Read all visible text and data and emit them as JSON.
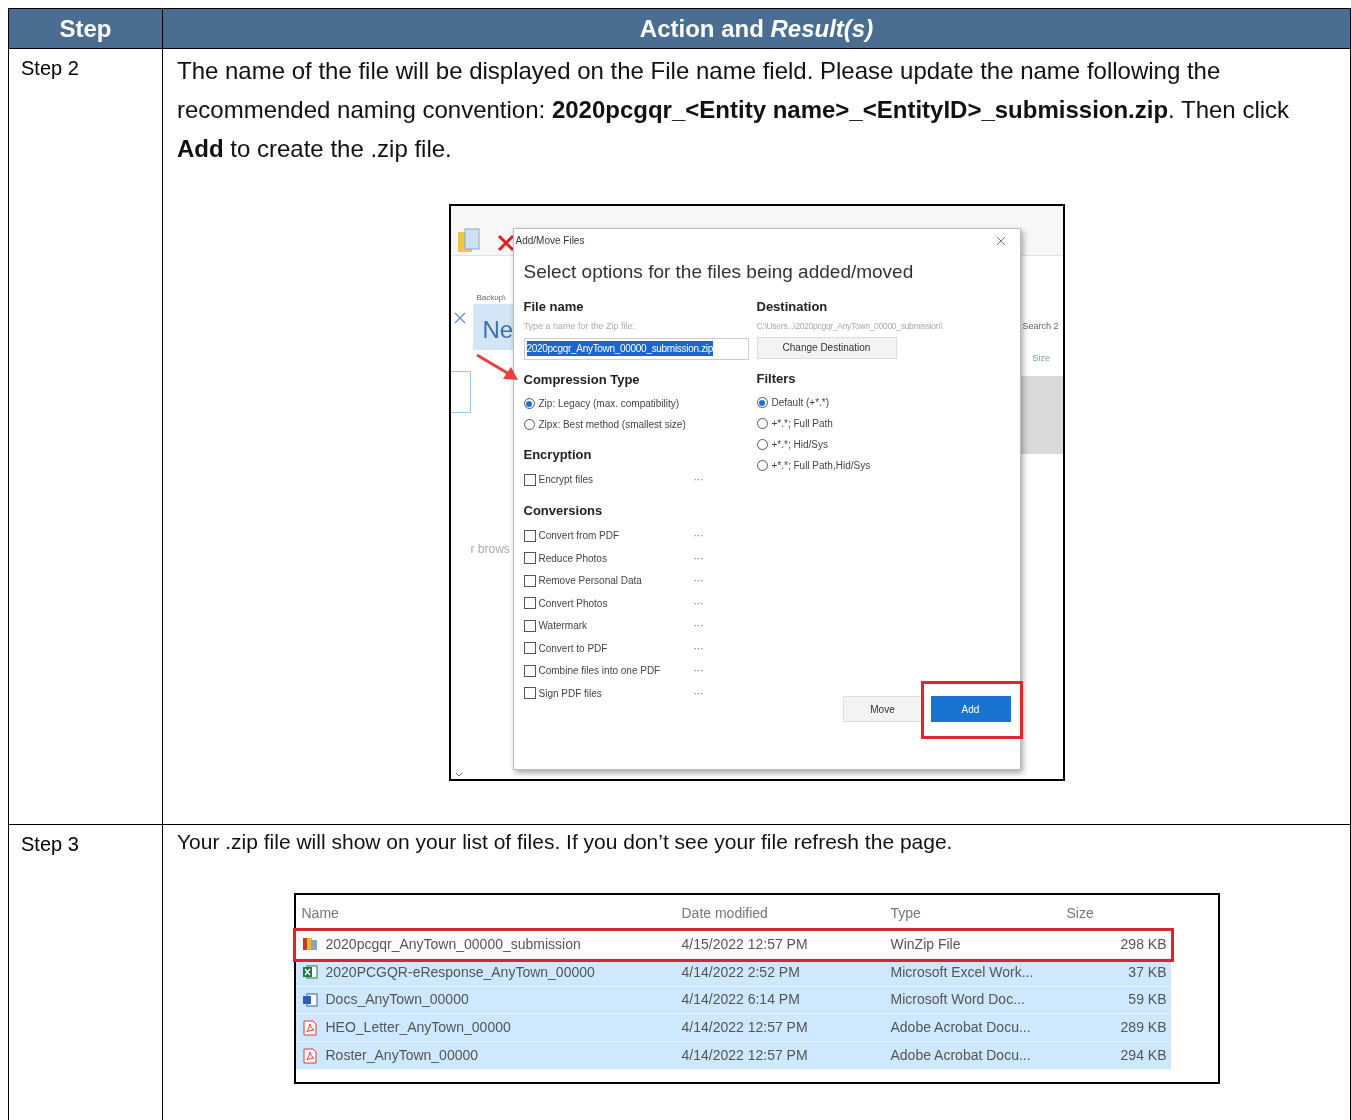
{
  "table": {
    "columns": [
      "Step",
      "Action and *Result(s)*"
    ],
    "rows": [
      {
        "step": "Step 2",
        "instruction": "The name of the file will be displayed on the File name field. Please update the name following the recommended naming convention: **2020pcgqr_<Entity name>_<EntityID>_submission.zip**. Then click **Add** to create the .zip file.",
        "screenshot": {
          "kind": "dialog",
          "background": {
            "breadcrumb": "Backup\\",
            "tile_label": "Ne",
            "search_hint": "Search 2",
            "column_header": "Size",
            "hint_fragment": "r brows"
          },
          "dialog": {
            "title": "Add/Move Files",
            "heading": "Select options for the files being added/moved",
            "file_name": {
              "label": "File name",
              "hint": "Type a name for the Zip file:",
              "value": "2020pcgqr_AnyTown_00000_submission.zip",
              "text_selected": true
            },
            "destination": {
              "label": "Destination",
              "path": "C:\\Users...\\2020pcgqr_AnyTown_00000_submission\\",
              "button": "Change Destination"
            },
            "compression": {
              "label": "Compression Type",
              "options": [
                {
                  "label": "Zip: Legacy (max. compatibility)",
                  "selected": true
                },
                {
                  "label": "Zipx: Best method (smallest size)",
                  "selected": false
                }
              ]
            },
            "encryption": {
              "label": "Encryption",
              "options": [
                {
                  "label": "Encrypt files",
                  "checked": false,
                  "more": "···"
                }
              ]
            },
            "conversions": {
              "label": "Conversions",
              "options": [
                {
                  "label": "Convert from PDF",
                  "checked": false,
                  "more": "···"
                },
                {
                  "label": "Reduce Photos",
                  "checked": false,
                  "more": "···"
                },
                {
                  "label": "Remove Personal Data",
                  "checked": false,
                  "more": "···"
                },
                {
                  "label": "Convert Photos",
                  "checked": false,
                  "more": "···"
                },
                {
                  "label": "Watermark",
                  "checked": false,
                  "more": "···"
                },
                {
                  "label": "Convert to PDF",
                  "checked": false,
                  "more": "···"
                },
                {
                  "label": "Combine files into one PDF",
                  "checked": false,
                  "more": "···"
                },
                {
                  "label": "Sign PDF files",
                  "checked": false,
                  "more": "···"
                }
              ]
            },
            "filters": {
              "label": "Filters",
              "options": [
                {
                  "label": "Default (+*.*)",
                  "selected": true
                },
                {
                  "label": "+*.*; Full Path",
                  "selected": false
                },
                {
                  "label": "+*.*; Hid/Sys",
                  "selected": false
                },
                {
                  "label": "+*.*; Full Path,Hid/Sys",
                  "selected": false
                }
              ]
            },
            "buttons": [
              {
                "label": "Move",
                "kind": "secondary",
                "highlighted": false
              },
              {
                "label": "Add",
                "kind": "primary",
                "highlighted": true
              }
            ]
          }
        }
      },
      {
        "step": "Step 3",
        "instruction": "Your .zip file will show on your list of files. If you don’t see your file refresh the page.",
        "screenshot": {
          "kind": "file_list",
          "columns": [
            "Name",
            "Date modified",
            "Type",
            "Size"
          ],
          "rows": [
            {
              "kind": "zip",
              "name": "2020pcgqr_AnyTown_00000_submission",
              "date": "4/15/2022 12:57 PM",
              "type": "WinZip File",
              "size": "298 KB",
              "selected": false,
              "highlighted": true
            },
            {
              "kind": "excel",
              "name": "2020PCGQR-eResponse_AnyTown_00000",
              "date": "4/14/2022 2:52 PM",
              "type": "Microsoft Excel Work...",
              "size": "37 KB",
              "selected": true,
              "highlighted": false
            },
            {
              "kind": "word",
              "name": "Docs_AnyTown_00000",
              "date": "4/14/2022 6:14 PM",
              "type": "Microsoft Word Doc...",
              "size": "59 KB",
              "selected": true,
              "highlighted": false
            },
            {
              "kind": "pdf",
              "name": "HEO_Letter_AnyTown_00000",
              "date": "4/14/2022 12:57 PM",
              "type": "Adobe Acrobat Docu...",
              "size": "289 KB",
              "selected": true,
              "highlighted": false
            },
            {
              "kind": "pdf",
              "name": "Roster_AnyTown_00000",
              "date": "4/14/2022 12:57 PM",
              "type": "Adobe Acrobat Docu...",
              "size": "294 KB",
              "selected": true,
              "highlighted": false
            }
          ]
        }
      }
    ]
  }
}
